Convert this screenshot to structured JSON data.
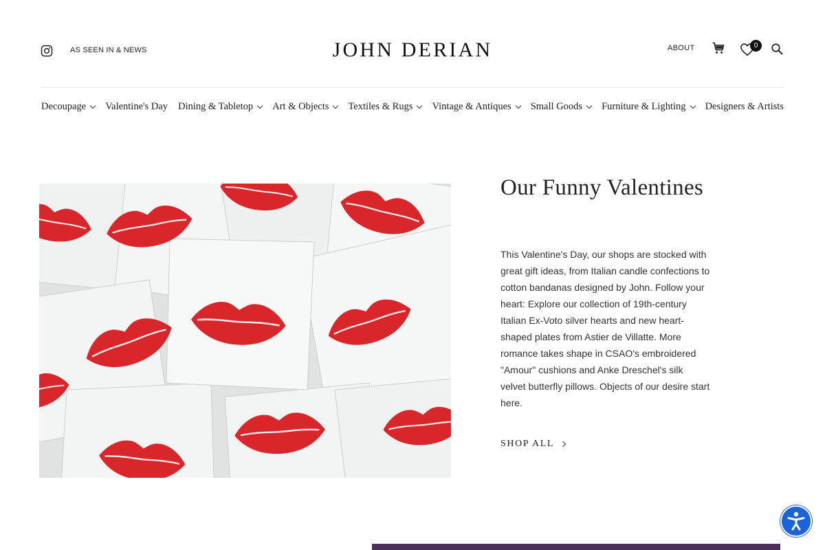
{
  "header": {
    "instagram_icon": "instagram-icon",
    "press_link": "AS SEEN IN & NEWS",
    "logo": "JOHN DERIAN",
    "about_link": "ABOUT",
    "cart_icon": "cart-icon",
    "wishlist_icon": "heart-icon",
    "wishlist_count": "0",
    "search_icon": "search-icon"
  },
  "nav": {
    "items": [
      {
        "label": "Decoupage",
        "has_dropdown": true
      },
      {
        "label": "Valentine's Day",
        "has_dropdown": false
      },
      {
        "label": "Dining & Tabletop",
        "has_dropdown": true
      },
      {
        "label": "Art & Objects",
        "has_dropdown": true
      },
      {
        "label": "Textiles & Rugs",
        "has_dropdown": true
      },
      {
        "label": "Vintage & Antiques",
        "has_dropdown": true
      },
      {
        "label": "Small Goods",
        "has_dropdown": true
      },
      {
        "label": "Furniture & Lighting",
        "has_dropdown": true
      },
      {
        "label": "Designers & Artists",
        "has_dropdown": false
      }
    ]
  },
  "feature": {
    "title": "Our Funny Valentines",
    "description": "This Valentine's Day, our shops are stocked with great gift ideas, from Italian candle confections to cotton bandanas designed by John. Follow your heart: Explore our collection of 19th-century Italian Ex-Voto silver hearts and new heart-shaped plates from Astier de Villatte. More romance takes shape in CSAO's embroidered \"Amour\" cushions and Anke Dreschel's silk velvet butterfly pillows. Objects of our desire start here.",
    "cta": "SHOP ALL",
    "image_icon": "lips-cards-image"
  },
  "accessibility": {
    "icon": "accessibility-icon"
  },
  "colors": {
    "lips_red": "#d8262a",
    "card_white": "#f6f8f7",
    "accessibility_blue": "#1a63d8",
    "text": "#222222"
  }
}
